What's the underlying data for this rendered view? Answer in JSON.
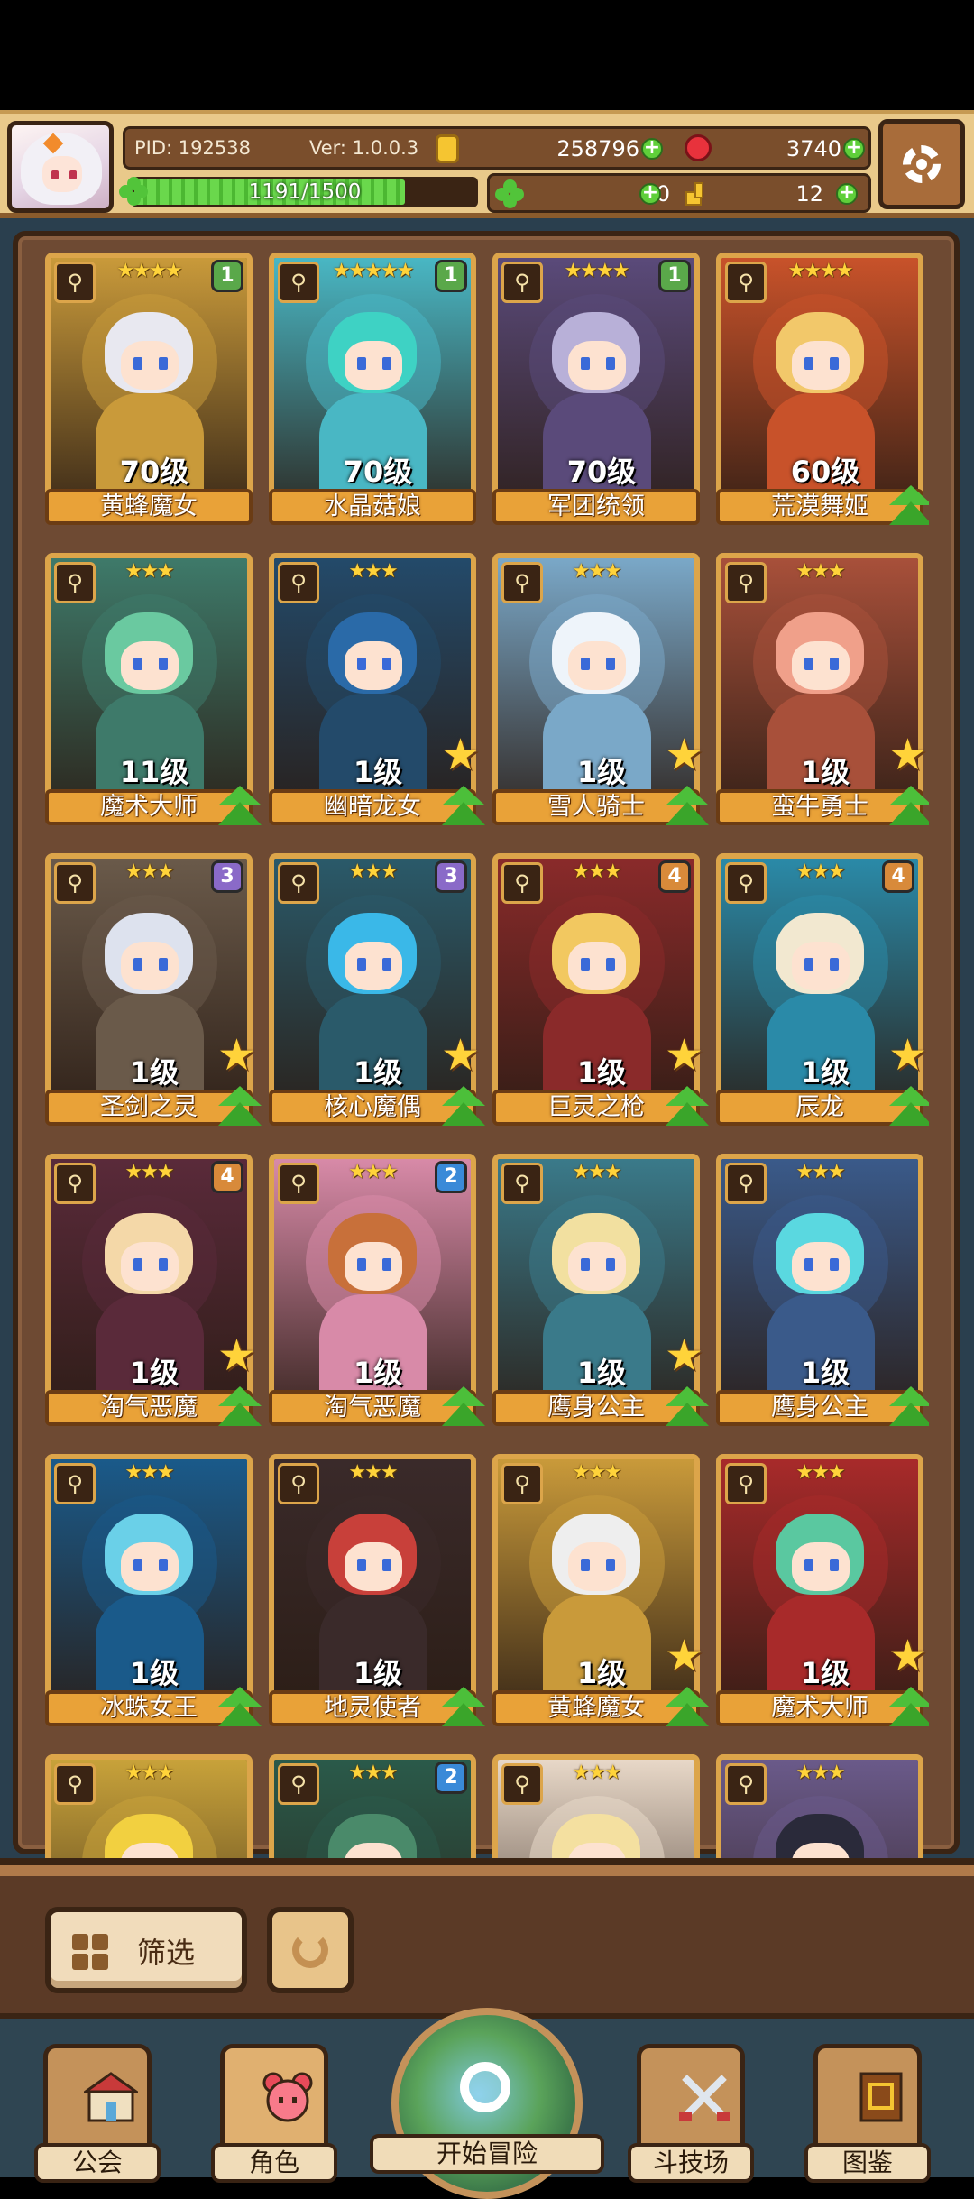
{
  "header": {
    "pid": "PID: 192538",
    "version": "Ver: 1.0.0.3",
    "gold": "258796",
    "gems": "3740",
    "exp": "1191/1500",
    "exp_fraction": 0.794,
    "clover": "10",
    "keys": "12"
  },
  "cards": [
    {
      "name": "黄蜂魔女",
      "level": "70级",
      "stars": "★★★★",
      "badge": "1",
      "badge_color": "#5aa84a",
      "theme": "#c99a3a",
      "hair": "#e8e8f0",
      "upgrade": false,
      "arrow": false
    },
    {
      "name": "水晶菇娘",
      "level": "70级",
      "stars": "★★★★★",
      "badge": "1",
      "badge_color": "#5aa84a",
      "theme": "#49b7c4",
      "hair": "#3ed2c4",
      "upgrade": false,
      "arrow": false
    },
    {
      "name": "军团统领",
      "level": "70级",
      "stars": "★★★★",
      "badge": "1",
      "badge_color": "#5aa84a",
      "theme": "#5a4a7a",
      "hair": "#b8b0d8",
      "upgrade": false,
      "arrow": false
    },
    {
      "name": "荒漠舞姬",
      "level": "60级",
      "stars": "★★★★",
      "badge": "",
      "badge_color": "",
      "theme": "#c8522a",
      "hair": "#f2c86a",
      "upgrade": false,
      "arrow": true
    },
    {
      "name": "魔术大师",
      "level": "11级",
      "stars": "★★★",
      "badge": "",
      "badge_color": "",
      "theme": "#3e7a6a",
      "hair": "#6ac9a0",
      "upgrade": false,
      "arrow": true
    },
    {
      "name": "幽暗龙女",
      "level": "1级",
      "stars": "★★★",
      "badge": "",
      "badge_color": "",
      "theme": "#234a6a",
      "hair": "#2a6aa8",
      "upgrade": true,
      "arrow": true
    },
    {
      "name": "雪人骑士",
      "level": "1级",
      "stars": "★★★",
      "badge": "",
      "badge_color": "",
      "theme": "#7aa8c8",
      "hair": "#eef4fa",
      "upgrade": true,
      "arrow": true
    },
    {
      "name": "蛮牛勇士",
      "level": "1级",
      "stars": "★★★",
      "badge": "",
      "badge_color": "",
      "theme": "#a8503a",
      "hair": "#f0a08a",
      "upgrade": true,
      "arrow": true
    },
    {
      "name": "圣剑之灵",
      "level": "1级",
      "stars": "★★★",
      "badge": "3",
      "badge_color": "#8a6ac8",
      "theme": "#6a5a4a",
      "hair": "#dde2ee",
      "upgrade": true,
      "arrow": true
    },
    {
      "name": "核心魔偶",
      "level": "1级",
      "stars": "★★★",
      "badge": "3",
      "badge_color": "#8a6ac8",
      "theme": "#2a5a6a",
      "hair": "#3ab8e8",
      "upgrade": true,
      "arrow": true
    },
    {
      "name": "巨灵之枪",
      "level": "1级",
      "stars": "★★★",
      "badge": "4",
      "badge_color": "#d88a3a",
      "theme": "#8a2a2a",
      "hair": "#f2c860",
      "upgrade": true,
      "arrow": true
    },
    {
      "name": "辰龙",
      "level": "1级",
      "stars": "★★★",
      "badge": "4",
      "badge_color": "#d88a3a",
      "theme": "#2a8aa8",
      "hair": "#f2e8d0",
      "upgrade": true,
      "arrow": true
    },
    {
      "name": "淘气恶魔",
      "level": "1级",
      "stars": "★★★",
      "badge": "4",
      "badge_color": "#d88a3a",
      "theme": "#5a2a3a",
      "hair": "#f4d8a8",
      "upgrade": true,
      "arrow": true
    },
    {
      "name": "淘气恶魔",
      "level": "1级",
      "stars": "★★★",
      "badge": "2",
      "badge_color": "#3a8ad8",
      "theme": "#d88aa8",
      "hair": "#c8703a",
      "upgrade": false,
      "arrow": true
    },
    {
      "name": "鹰身公主",
      "level": "1级",
      "stars": "★★★",
      "badge": "",
      "badge_color": "",
      "theme": "#3a7a8a",
      "hair": "#f2e0a0",
      "upgrade": true,
      "arrow": true
    },
    {
      "name": "鹰身公主",
      "level": "1级",
      "stars": "★★★",
      "badge": "",
      "badge_color": "",
      "theme": "#3a5a8a",
      "hair": "#5ad8e0",
      "upgrade": false,
      "arrow": true
    },
    {
      "name": "冰蛛女王",
      "level": "1级",
      "stars": "★★★",
      "badge": "",
      "badge_color": "",
      "theme": "#1a5a8a",
      "hair": "#6ad0e8",
      "upgrade": false,
      "arrow": true
    },
    {
      "name": "地灵使者",
      "level": "1级",
      "stars": "★★★",
      "badge": "",
      "badge_color": "",
      "theme": "#3a2a2a",
      "hair": "#c8403a",
      "upgrade": false,
      "arrow": true
    },
    {
      "name": "黄蜂魔女",
      "level": "1级",
      "stars": "★★★",
      "badge": "",
      "badge_color": "",
      "theme": "#c99a3a",
      "hair": "#eeeeee",
      "upgrade": true,
      "arrow": true
    },
    {
      "name": "魔术大师",
      "level": "1级",
      "stars": "★★★",
      "badge": "",
      "badge_color": "",
      "theme": "#a82a2a",
      "hair": "#5ac8a0",
      "upgrade": true,
      "arrow": true
    },
    {
      "name": "",
      "level": "",
      "stars": "★★★",
      "badge": "",
      "badge_color": "",
      "theme": "#c8a23a",
      "hair": "#f2d040",
      "upgrade": false,
      "arrow": false
    },
    {
      "name": "",
      "level": "",
      "stars": "★★★",
      "badge": "2",
      "badge_color": "#3a8ad8",
      "theme": "#2a5a4a",
      "hair": "#4a8a6a",
      "upgrade": false,
      "arrow": false
    },
    {
      "name": "",
      "level": "",
      "stars": "★★★",
      "badge": "",
      "badge_color": "",
      "theme": "#e8d8c8",
      "hair": "#f4e0a0",
      "upgrade": false,
      "arrow": false
    },
    {
      "name": "",
      "level": "",
      "stars": "★★★",
      "badge": "",
      "badge_color": "",
      "theme": "#6a5a8a",
      "hair": "#2a2a3a",
      "upgrade": false,
      "arrow": false
    }
  ],
  "filter": {
    "label": "筛选"
  },
  "nav": {
    "guild": "公会",
    "character": "角色",
    "adventure": "开始冒险",
    "arena": "斗技场",
    "codex": "图鉴"
  }
}
